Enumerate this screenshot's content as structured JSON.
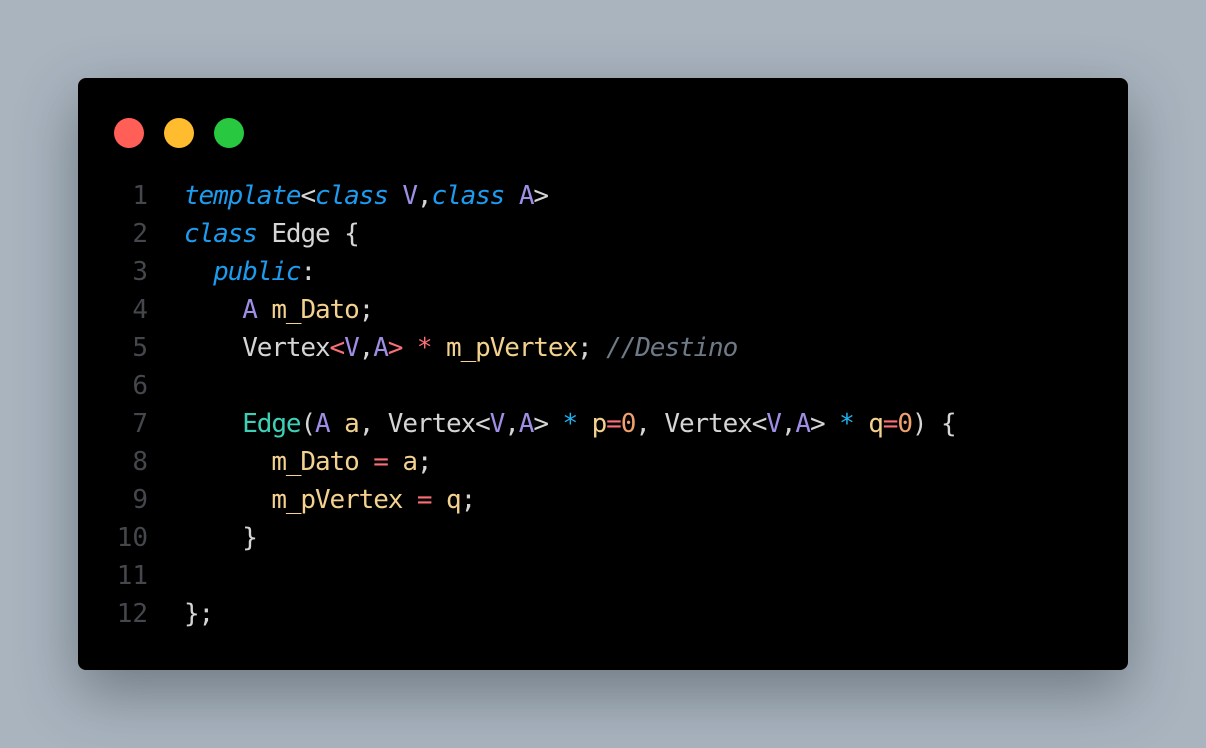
{
  "window": {
    "buttons": [
      {
        "name": "close-button",
        "color": "#ff5f57"
      },
      {
        "name": "minimize-button",
        "color": "#febc2e"
      },
      {
        "name": "zoom-button",
        "color": "#28c840"
      }
    ]
  },
  "colors": {
    "default": "#d5d5d5",
    "keyword": "#1d9bef",
    "type": "#a08ee6",
    "member": "#f3d28f",
    "operator": "#fb6f76",
    "pointer": "#1fb2f0",
    "number": "#f1a16c",
    "function": "#3ed0b6",
    "comment": "#6f7a87"
  },
  "code": {
    "lines": [
      {
        "num": "1",
        "indent": "",
        "tokens": [
          {
            "t": "template",
            "c": "keyword"
          },
          {
            "t": "<",
            "c": "default"
          },
          {
            "t": "class",
            "c": "keyword"
          },
          {
            "t": " ",
            "c": "default"
          },
          {
            "t": "V",
            "c": "type"
          },
          {
            "t": ",",
            "c": "default"
          },
          {
            "t": "class",
            "c": "keyword"
          },
          {
            "t": " ",
            "c": "default"
          },
          {
            "t": "A",
            "c": "type"
          },
          {
            "t": ">",
            "c": "default"
          }
        ]
      },
      {
        "num": "2",
        "indent": "",
        "tokens": [
          {
            "t": "class",
            "c": "keyword"
          },
          {
            "t": " Edge {",
            "c": "default"
          }
        ]
      },
      {
        "num": "3",
        "indent": "  ",
        "tokens": [
          {
            "t": "public",
            "c": "keyword"
          },
          {
            "t": ":",
            "c": "default"
          }
        ]
      },
      {
        "num": "4",
        "indent": "    ",
        "tokens": [
          {
            "t": "A",
            "c": "type"
          },
          {
            "t": " ",
            "c": "default"
          },
          {
            "t": "m_Dato",
            "c": "member"
          },
          {
            "t": ";",
            "c": "default"
          }
        ]
      },
      {
        "num": "5",
        "indent": "    ",
        "tokens": [
          {
            "t": "Vertex",
            "c": "default"
          },
          {
            "t": "<",
            "c": "operator"
          },
          {
            "t": "V",
            "c": "type"
          },
          {
            "t": ",",
            "c": "default"
          },
          {
            "t": "A",
            "c": "type"
          },
          {
            "t": ">",
            "c": "operator"
          },
          {
            "t": " ",
            "c": "default"
          },
          {
            "t": "*",
            "c": "operator"
          },
          {
            "t": " ",
            "c": "default"
          },
          {
            "t": "m_pVertex",
            "c": "member"
          },
          {
            "t": "; ",
            "c": "default"
          },
          {
            "t": "//Destino",
            "c": "comment"
          }
        ]
      },
      {
        "num": "6",
        "indent": "",
        "tokens": []
      },
      {
        "num": "7",
        "indent": "    ",
        "tokens": [
          {
            "t": "Edge",
            "c": "function"
          },
          {
            "t": "(",
            "c": "default"
          },
          {
            "t": "A",
            "c": "type"
          },
          {
            "t": " ",
            "c": "default"
          },
          {
            "t": "a",
            "c": "member"
          },
          {
            "t": ", Vertex<",
            "c": "default"
          },
          {
            "t": "V",
            "c": "type"
          },
          {
            "t": ",",
            "c": "default"
          },
          {
            "t": "A",
            "c": "type"
          },
          {
            "t": "> ",
            "c": "default"
          },
          {
            "t": "*",
            "c": "pointer"
          },
          {
            "t": " ",
            "c": "default"
          },
          {
            "t": "p",
            "c": "member"
          },
          {
            "t": "=",
            "c": "operator"
          },
          {
            "t": "0",
            "c": "number"
          },
          {
            "t": ", Vertex<",
            "c": "default"
          },
          {
            "t": "V",
            "c": "type"
          },
          {
            "t": ",",
            "c": "default"
          },
          {
            "t": "A",
            "c": "type"
          },
          {
            "t": "> ",
            "c": "default"
          },
          {
            "t": "*",
            "c": "pointer"
          },
          {
            "t": " ",
            "c": "default"
          },
          {
            "t": "q",
            "c": "member"
          },
          {
            "t": "=",
            "c": "operator"
          },
          {
            "t": "0",
            "c": "number"
          },
          {
            "t": ") {",
            "c": "default"
          }
        ]
      },
      {
        "num": "8",
        "indent": "      ",
        "tokens": [
          {
            "t": "m_Dato",
            "c": "member"
          },
          {
            "t": " ",
            "c": "default"
          },
          {
            "t": "=",
            "c": "operator"
          },
          {
            "t": " ",
            "c": "default"
          },
          {
            "t": "a",
            "c": "member"
          },
          {
            "t": ";",
            "c": "default"
          }
        ]
      },
      {
        "num": "9",
        "indent": "      ",
        "tokens": [
          {
            "t": "m_pVertex",
            "c": "member"
          },
          {
            "t": " ",
            "c": "default"
          },
          {
            "t": "=",
            "c": "operator"
          },
          {
            "t": " ",
            "c": "default"
          },
          {
            "t": "q",
            "c": "member"
          },
          {
            "t": ";",
            "c": "default"
          }
        ]
      },
      {
        "num": "10",
        "indent": "    ",
        "tokens": [
          {
            "t": "}",
            "c": "default"
          }
        ]
      },
      {
        "num": "11",
        "indent": "",
        "tokens": []
      },
      {
        "num": "12",
        "indent": "",
        "tokens": [
          {
            "t": "};",
            "c": "default"
          }
        ]
      }
    ]
  }
}
